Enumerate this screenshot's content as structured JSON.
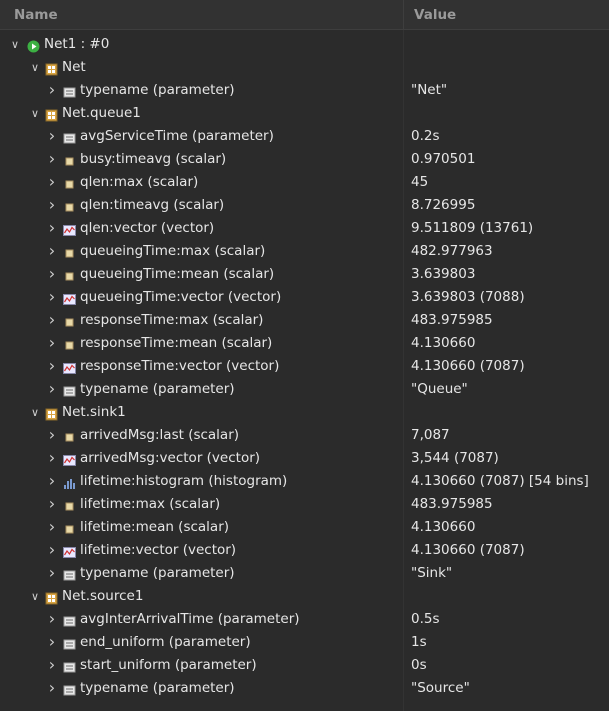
{
  "header": {
    "name": "Name",
    "value": "Value"
  },
  "rows": [
    {
      "level": 0,
      "expand": "down",
      "icon": "run-icon",
      "label": "Net1 : #0",
      "value": ""
    },
    {
      "level": 1,
      "expand": "down",
      "icon": "module-icon",
      "label": "Net",
      "value": ""
    },
    {
      "level": 2,
      "expand": "right",
      "icon": "parameter-icon",
      "label": "typename (parameter)",
      "value": "\"Net\""
    },
    {
      "level": 1,
      "expand": "down",
      "icon": "module-icon",
      "label": "Net.queue1",
      "value": ""
    },
    {
      "level": 2,
      "expand": "right",
      "icon": "parameter-icon",
      "label": "avgServiceTime (parameter)",
      "value": "0.2s"
    },
    {
      "level": 2,
      "expand": "right",
      "icon": "scalar-icon",
      "label": "busy:timeavg (scalar)",
      "value": "0.970501"
    },
    {
      "level": 2,
      "expand": "right",
      "icon": "scalar-icon",
      "label": "qlen:max (scalar)",
      "value": "45"
    },
    {
      "level": 2,
      "expand": "right",
      "icon": "scalar-icon",
      "label": "qlen:timeavg (scalar)",
      "value": "8.726995"
    },
    {
      "level": 2,
      "expand": "right",
      "icon": "vector-icon",
      "label": "qlen:vector (vector)",
      "value": "9.511809 (13761)"
    },
    {
      "level": 2,
      "expand": "right",
      "icon": "scalar-icon",
      "label": "queueingTime:max (scalar)",
      "value": "482.977963"
    },
    {
      "level": 2,
      "expand": "right",
      "icon": "scalar-icon",
      "label": "queueingTime:mean (scalar)",
      "value": "3.639803"
    },
    {
      "level": 2,
      "expand": "right",
      "icon": "vector-icon",
      "label": "queueingTime:vector (vector)",
      "value": "3.639803 (7088)"
    },
    {
      "level": 2,
      "expand": "right",
      "icon": "scalar-icon",
      "label": "responseTime:max (scalar)",
      "value": "483.975985"
    },
    {
      "level": 2,
      "expand": "right",
      "icon": "scalar-icon",
      "label": "responseTime:mean (scalar)",
      "value": "4.130660"
    },
    {
      "level": 2,
      "expand": "right",
      "icon": "vector-icon",
      "label": "responseTime:vector (vector)",
      "value": "4.130660 (7087)"
    },
    {
      "level": 2,
      "expand": "right",
      "icon": "parameter-icon",
      "label": "typename (parameter)",
      "value": "\"Queue\""
    },
    {
      "level": 1,
      "expand": "down",
      "icon": "module-icon",
      "label": "Net.sink1",
      "value": ""
    },
    {
      "level": 2,
      "expand": "right",
      "icon": "scalar-icon",
      "label": "arrivedMsg:last (scalar)",
      "value": "7,087"
    },
    {
      "level": 2,
      "expand": "right",
      "icon": "vector-icon",
      "label": "arrivedMsg:vector (vector)",
      "value": "3,544 (7087)"
    },
    {
      "level": 2,
      "expand": "right",
      "icon": "histogram-icon",
      "label": "lifetime:histogram (histogram)",
      "value": "4.130660 (7087) [54 bins]"
    },
    {
      "level": 2,
      "expand": "right",
      "icon": "scalar-icon",
      "label": "lifetime:max (scalar)",
      "value": "483.975985"
    },
    {
      "level": 2,
      "expand": "right",
      "icon": "scalar-icon",
      "label": "lifetime:mean (scalar)",
      "value": "4.130660"
    },
    {
      "level": 2,
      "expand": "right",
      "icon": "vector-icon",
      "label": "lifetime:vector (vector)",
      "value": "4.130660 (7087)"
    },
    {
      "level": 2,
      "expand": "right",
      "icon": "parameter-icon",
      "label": "typename (parameter)",
      "value": "\"Sink\""
    },
    {
      "level": 1,
      "expand": "down",
      "icon": "module-icon",
      "label": "Net.source1",
      "value": ""
    },
    {
      "level": 2,
      "expand": "right",
      "icon": "parameter-icon",
      "label": "avgInterArrivalTime (parameter)",
      "value": "0.5s"
    },
    {
      "level": 2,
      "expand": "right",
      "icon": "parameter-icon",
      "label": "end_uniform (parameter)",
      "value": "1s"
    },
    {
      "level": 2,
      "expand": "right",
      "icon": "parameter-icon",
      "label": "start_uniform (parameter)",
      "value": "0s"
    },
    {
      "level": 2,
      "expand": "right",
      "icon": "parameter-icon",
      "label": "typename (parameter)",
      "value": "\"Source\""
    }
  ],
  "colors": {
    "background": "#2b2b2b",
    "header": "#323232",
    "text": "#e6e6e6",
    "run_icon": "#3cb043",
    "module_icon": "#d9a441"
  }
}
